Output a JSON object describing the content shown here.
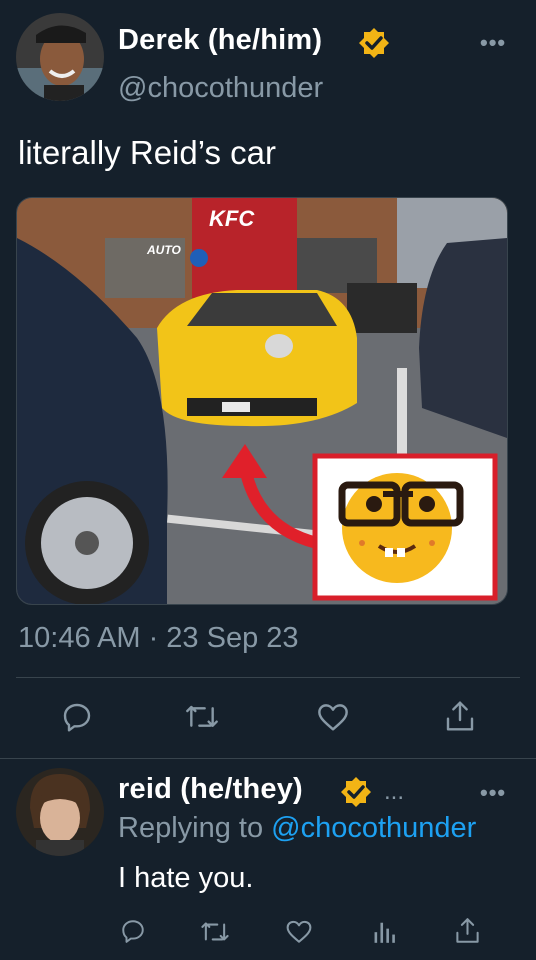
{
  "tweet": {
    "author_name": "Derek (he/him)",
    "author_handle": "@chocothunder",
    "more_label": "•••",
    "text": "literally Reid’s car",
    "timestamp": "10:46 AM · 23 Sep 23",
    "image": {
      "sign_brand": "KFC",
      "sign_auto": "AUTO"
    }
  },
  "reply": {
    "author_name": "reid (he/they)",
    "extra_dots": "...",
    "more_label": "•••",
    "replying_prefix": "Replying to ",
    "replying_handle": "@chocothunder",
    "text": "I hate you."
  },
  "actions": [
    "reply-icon",
    "retweet-icon",
    "like-icon",
    "share-icon"
  ],
  "reply_actions": [
    "reply-icon",
    "retweet-icon",
    "like-icon",
    "analytics-icon",
    "share-icon"
  ],
  "colors": {
    "background": "#15202b",
    "secondary_text": "#8899a6",
    "link": "#1da1f2",
    "verified_badge": "#f2b415",
    "divider": "#38444d"
  }
}
